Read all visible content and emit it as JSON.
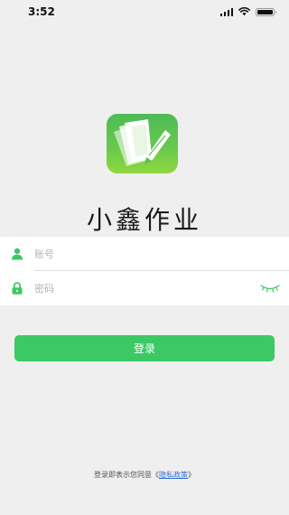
{
  "status_bar": {
    "time": "3:52"
  },
  "app": {
    "title": "小鑫作业",
    "logo_icon": "book-pencil-icon"
  },
  "form": {
    "account": {
      "placeholder": "账号",
      "value": "",
      "icon": "user-icon"
    },
    "password": {
      "placeholder": "密码",
      "value": "",
      "icon": "lock-icon",
      "toggle_icon": "eye-closed-icon"
    }
  },
  "login_button": {
    "label": "登录"
  },
  "agreement": {
    "prefix": "登录即表示您同意",
    "open_bracket": "《",
    "link_text": "隐私政策",
    "close_bracket": "》"
  },
  "colors": {
    "accent": "#3cc864",
    "link": "#2f6fd6",
    "background": "#efefef",
    "icon_green": "#3cc864"
  }
}
